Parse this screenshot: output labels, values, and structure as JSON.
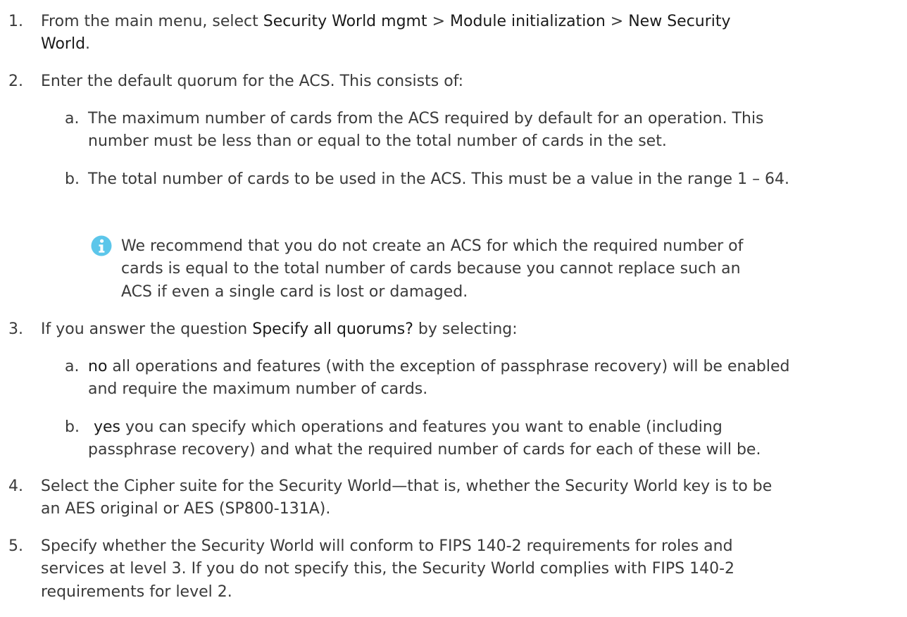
{
  "colors": {
    "text": "#3a3a3a",
    "emphasis": "#1a1a1a",
    "note_icon": "#5cc6ea"
  },
  "icons": {
    "note": "info-icon"
  },
  "steps": {
    "s1": {
      "number": "1.",
      "pre": "From the main menu, select ",
      "menu1": "Security World mgmt",
      "sep1": " > ",
      "menu2": "Module initialization",
      "sep2": " > ",
      "menu3a": "New Security",
      "menu3b": "World",
      "post": "."
    },
    "s2": {
      "number": "2.",
      "text": "Enter the default quorum for the ACS. This consists of:",
      "a": {
        "letter": "a.",
        "line1": "The maximum number of cards from the ACS required by default for an operation. This",
        "line2": "number must be less than or equal to the total number of cards in the set."
      },
      "b": {
        "letter": "b.",
        "line1": "The total number of cards to be used in the ACS. This must be a value in the range 1 – 64."
      },
      "note": {
        "line1": "We recommend that you do not create an ACS for which the required number of",
        "line2": "cards is equal to the total number of cards because you cannot replace such an",
        "line3": "ACS if even a single card is lost or damaged."
      }
    },
    "s3": {
      "number": "3.",
      "pre": "If you answer the question ",
      "question": "Specify all quorums?",
      "post": " by selecting:",
      "a": {
        "letter": "a.",
        "keyword": "no",
        "line1": " all operations and features (with the exception of passphrase recovery) will be enabled",
        "line2": "and require the maximum number of cards."
      },
      "b": {
        "letter": "b.",
        "keyword": "yes",
        "line1": " you can specify which operations and features you want to enable (including",
        "line2": "passphrase recovery) and what the required number of cards for each of these will be."
      }
    },
    "s4": {
      "number": "4.",
      "line1": "Select the Cipher suite for the Security World—that is, whether the Security World key is to be",
      "line2": "an AES original or AES (SP800-131A)."
    },
    "s5": {
      "number": "5.",
      "line1": "Specify whether the Security World will conform to FIPS 140-2 requirements for roles and",
      "line2": "services at level 3. If you do not specify this, the Security World complies with FIPS 140-2",
      "line3": "requirements for level 2."
    }
  }
}
